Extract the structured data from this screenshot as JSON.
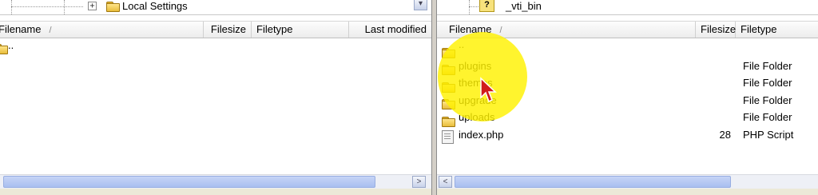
{
  "left_tree": {
    "label": "Local Settings",
    "expander": "+"
  },
  "right_tree": {
    "label": "_vti_bin"
  },
  "left_list": {
    "columns": [
      "Filename",
      "Filesize",
      "Filetype",
      "Last modified"
    ],
    "sort_indicator": "/",
    "rows": [
      {
        "name": ".."
      }
    ]
  },
  "right_list": {
    "columns": [
      "Filename",
      "Filesize",
      "Filetype"
    ],
    "sort_indicator": "/",
    "rows": [
      {
        "name": "..",
        "size": "",
        "type": ""
      },
      {
        "name": "plugins",
        "size": "",
        "type": "File Folder"
      },
      {
        "name": "themes",
        "size": "",
        "type": "File Folder"
      },
      {
        "name": "upgrade",
        "size": "",
        "type": "File Folder"
      },
      {
        "name": "uploads",
        "size": "",
        "type": "File Folder"
      },
      {
        "name": "index.php",
        "size": "28",
        "type": "PHP Script"
      }
    ]
  },
  "scrollbars": {
    "left_arrow": "<",
    "right_arrow": ">",
    "left_pane_thumb_fraction": 0.9,
    "right_pane_thumb_fraction": 0.4
  },
  "colors": {
    "highlight": "#fff200",
    "cursor": "#d01c1c",
    "folder": "#e8bd3b"
  }
}
